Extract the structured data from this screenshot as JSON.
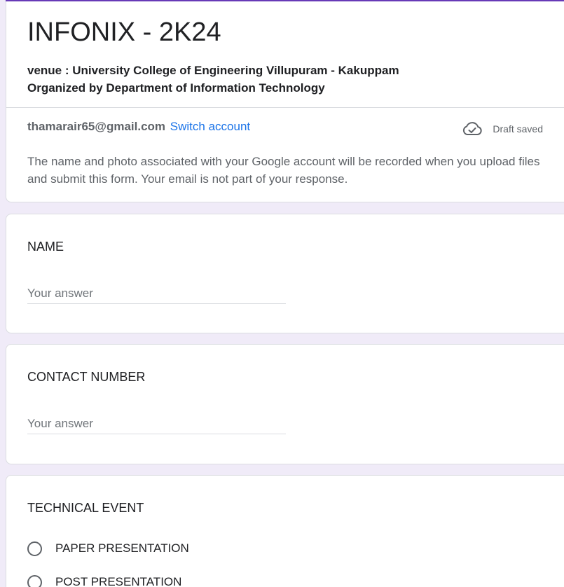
{
  "form": {
    "title": "INFONIX - 2K24",
    "description_line1": "venue : University College of Engineering Villupuram - Kakuppam",
    "description_line2": "Organized by Department of Information Technology",
    "accent_color": "#673ab7"
  },
  "account": {
    "email": "thamarair65@gmail.com",
    "switch_label": "Switch account",
    "draft_status": "Draft saved",
    "draft_icon": "cloud-check-icon",
    "privacy_note": "The name and photo associated with your Google account will be recorded when you upload files and submit this form. Your email is not part of your response."
  },
  "questions": {
    "name": {
      "title": "NAME",
      "placeholder": "Your answer"
    },
    "contact": {
      "title": "CONTACT NUMBER",
      "placeholder": "Your answer"
    },
    "technical_event": {
      "title": "TECHNICAL EVENT",
      "options": [
        "PAPER PRESENTATION",
        "POST PRESENTATION"
      ]
    }
  },
  "colors": {
    "background": "#f0ebf8",
    "link": "#1a73e8"
  }
}
